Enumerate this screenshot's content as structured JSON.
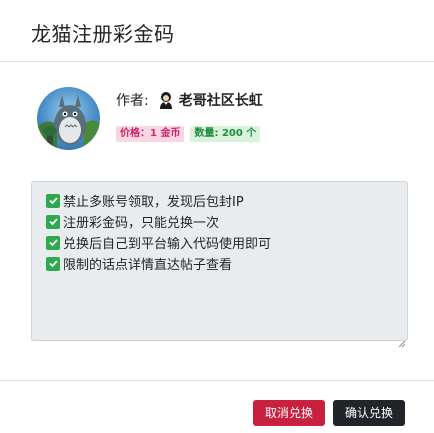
{
  "modal": {
    "title": "龙猫注册彩金码"
  },
  "item": {
    "author_label": "作者:",
    "author_name": "老哥社区长虹",
    "price_label": "价格：",
    "price_value": "1 金币",
    "quantity_label": "数量:",
    "quantity_value": "200 个"
  },
  "description": {
    "lines": [
      "禁止多账号领取，发现后包封IP",
      "注册彩金码，只能兑换一次",
      "兑换后自己到平台输入代码使用即可",
      "限制的话点详情直达帖子查看"
    ]
  },
  "footer": {
    "cancel_label": "取消兑换",
    "confirm_label": "确认兑换"
  },
  "colors": {
    "cancel_button": "#c8203f",
    "confirm_button": "#212529",
    "price_badge_text": "#d0246a",
    "quantity_badge_text": "#1e8e3e",
    "check_icon": "#2fa84f"
  }
}
